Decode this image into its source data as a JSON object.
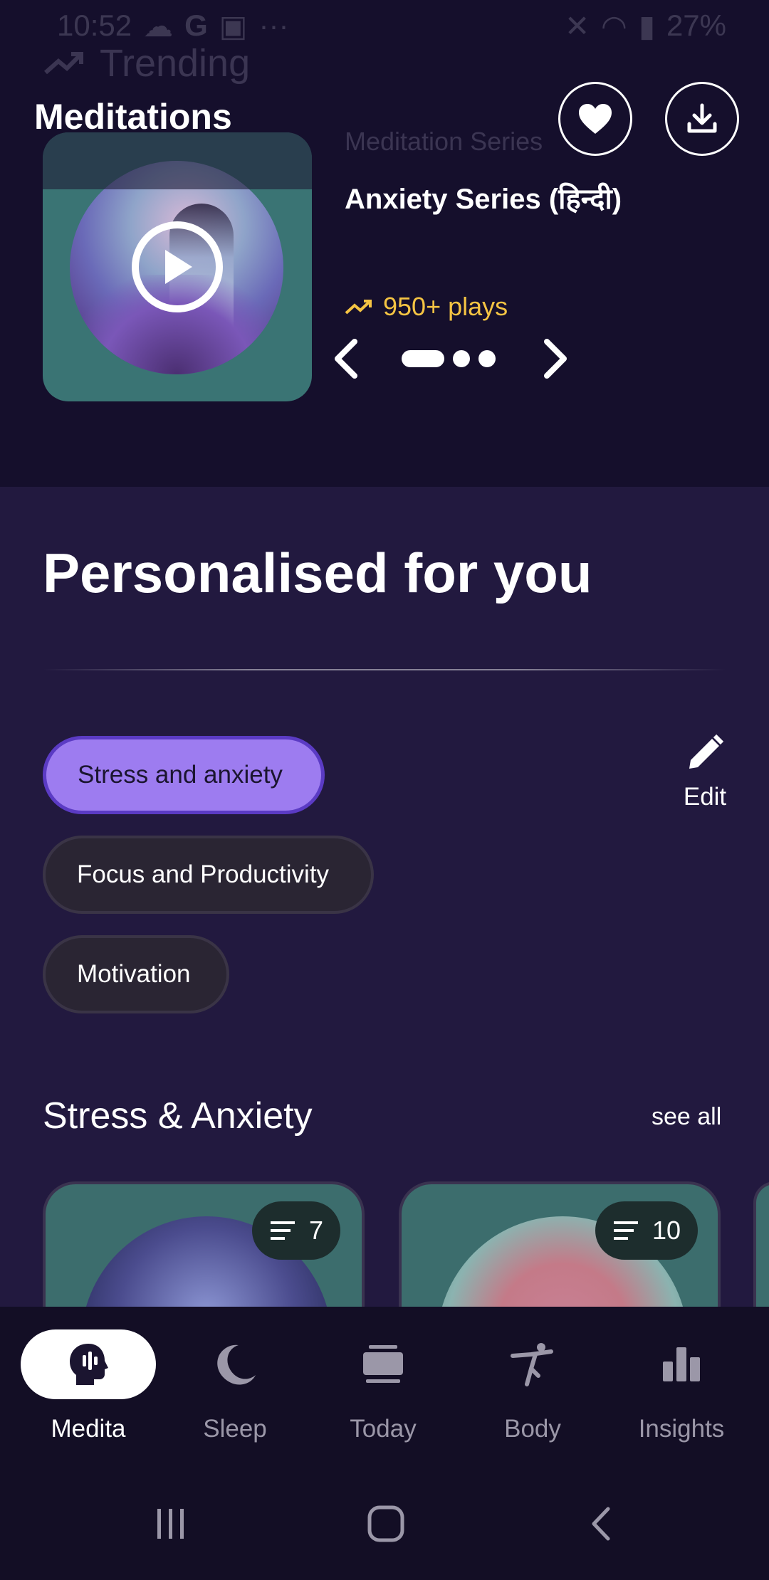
{
  "status_bar": {
    "time": "10:52",
    "icons_left": [
      "cloud-icon",
      "google-icon",
      "teams-icon",
      "more-icon"
    ],
    "icons_right": [
      "mute-icon",
      "wifi-icon",
      "signal-icon"
    ],
    "battery": "27%"
  },
  "header": {
    "faded_label": "Trending",
    "title": "Meditations",
    "favorite_icon": "heart-icon",
    "download_icon": "download-icon"
  },
  "featured": {
    "kicker": "Meditation Series",
    "title": "Anxiety Series (हिन्दी)",
    "plays": "950+ plays",
    "carousel_dots": 3,
    "active_dot": 0
  },
  "personalised": {
    "title": "Personalised for you",
    "chips": [
      {
        "label": "Stress and anxiety",
        "selected": true
      },
      {
        "label": "Focus and Productivity",
        "selected": false
      },
      {
        "label": "Motivation",
        "selected": false
      }
    ],
    "edit_label": "Edit"
  },
  "stress_section": {
    "title": "Stress & Anxiety",
    "see_all": "see all",
    "cards": [
      {
        "count": "7"
      },
      {
        "count": "10"
      }
    ]
  },
  "bottom_nav": [
    {
      "label": "Medita",
      "icon": "meditation-head-icon",
      "active": true
    },
    {
      "label": "Sleep",
      "icon": "moon-icon",
      "active": false
    },
    {
      "label": "Today",
      "icon": "stack-icon",
      "active": false
    },
    {
      "label": "Body",
      "icon": "yoga-pose-icon",
      "active": false
    },
    {
      "label": "Insights",
      "icon": "bar-chart-icon",
      "active": false
    }
  ],
  "colors": {
    "background": "#22193f",
    "header_background": "#150f2c",
    "accent": "#9d7cf0",
    "plays_color": "#f5c443"
  }
}
